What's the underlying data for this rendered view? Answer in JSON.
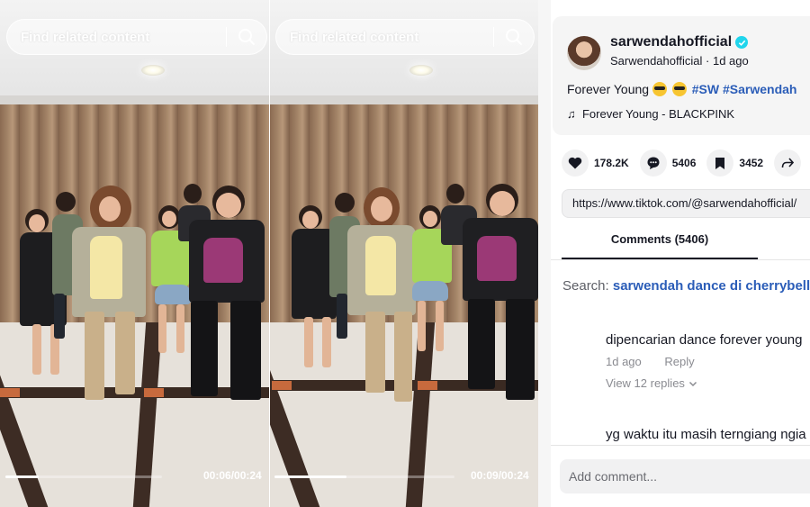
{
  "videos": [
    {
      "search_placeholder": "Find related content",
      "timecode": "00:06/00:24",
      "progress": 0.21
    },
    {
      "search_placeholder": "Find related content",
      "timecode": "00:09/00:24",
      "progress": 0.4
    }
  ],
  "post": {
    "username": "sarwendahofficial",
    "display_name": "Sarwendahofficial",
    "age": "1d ago",
    "subline_separator": "·",
    "caption_text": "Forever Young",
    "hashtags": [
      "#SW",
      "#Sarwendah"
    ],
    "music": "Forever Young - BLACKPINK"
  },
  "stats": {
    "likes": "178.2K",
    "comments": "5406",
    "saves": "3452"
  },
  "share_url": "https://www.tiktok.com/@sarwendahofficial/",
  "comments_tab_label": "Comments (5406)",
  "search_suggestion": {
    "prefix": "Search:",
    "query": "sarwendah dance di cherrybelle"
  },
  "comments": [
    {
      "text": "dipencarian dance forever young",
      "time": "1d ago",
      "reply_label": "Reply",
      "view_replies": "View 12 replies"
    },
    {
      "text": "yg waktu itu masih terngiang ngia"
    }
  ],
  "add_comment_placeholder": "Add comment...",
  "colors": {
    "hashtag": "#2b5db8",
    "verified": "#20d5ec",
    "text": "#161823"
  }
}
